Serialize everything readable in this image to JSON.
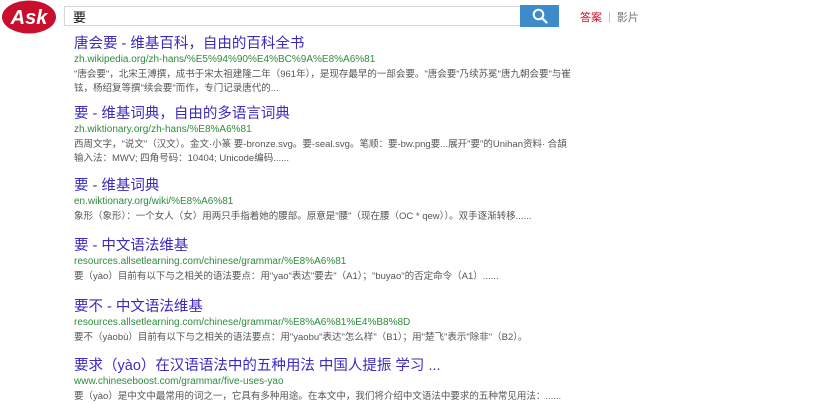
{
  "brand": {
    "logo_text": "Ask",
    "logo_color": "#c8102e"
  },
  "search": {
    "query": "要"
  },
  "tabs": [
    {
      "label": "答案",
      "active": true
    },
    {
      "label": "影片",
      "active": false
    }
  ],
  "tab_separator": "|",
  "results": [
    {
      "title": "唐会要 - 维基百科，自由的百科全书",
      "url": "zh.wikipedia.org/zh-hans/%E5%94%90%E4%BC%9A%E8%A6%81",
      "snippet": "\"唐会要\"，北宋王溥撰，成书于宋太祖建隆二年（961年），是现存最早的一部会要。\"唐会要\"乃续苏冕\"唐九朝会要\"与崔铉，杨绍复等撰\"续会要\"而作，专门记录唐代的..."
    },
    {
      "title": "要 - 维基词典，自由的多语言词典",
      "url": "zh.wiktionary.org/zh-hans/%E8%A6%81",
      "snippet": "西周文字，\"说文\"（汉文）。金文·小篆 要-bronze.svg。要-seal.svg。笔顺：要-bw.png要...展开\"要\"的Unihan资料· 合頡输入法：MWV; 四角号码：10404; Unicode编码......"
    },
    {
      "title": "要 - 维基词典",
      "url": "en.wiktionary.org/wiki/%E8%A6%81",
      "snippet": "象形（象形）：一个女人（女）用两只手指着她的腰部。原意是\"腰\"（现在腰（OC * qew））。双手逐渐转移......"
    },
    {
      "title": "要 - 中文语法维基",
      "url": "resources.allsetlearning.com/chinese/grammar/%E8%A6%81",
      "snippet": "要（yào）目前有以下与之相关的语法要点：用\"yao\"表达\"要去\"（A1）；\"buyao\"的否定命令（A1）......"
    },
    {
      "title": "要不 - 中文语法维基",
      "url": "resources.allsetlearning.com/chinese/grammar/%E8%A6%81%E4%B8%8D",
      "snippet": "要不（yàobù）目前有以下与之相关的语法要点：用\"yaobu\"表达\"怎么样\"（B1）；用\"楚飞\"表示\"除非\"（B2）。"
    },
    {
      "title": "要求（yào）在汉语语法中的五种用法 中国人提振 学习 ...",
      "url": "www.chineseboost.com/grammar/five-uses-yao",
      "snippet": "要（yào）是中文中最常用的词之一，它具有多种用途。在本文中，我们将介绍中文语法中要求的五种常见用法：......"
    }
  ]
}
